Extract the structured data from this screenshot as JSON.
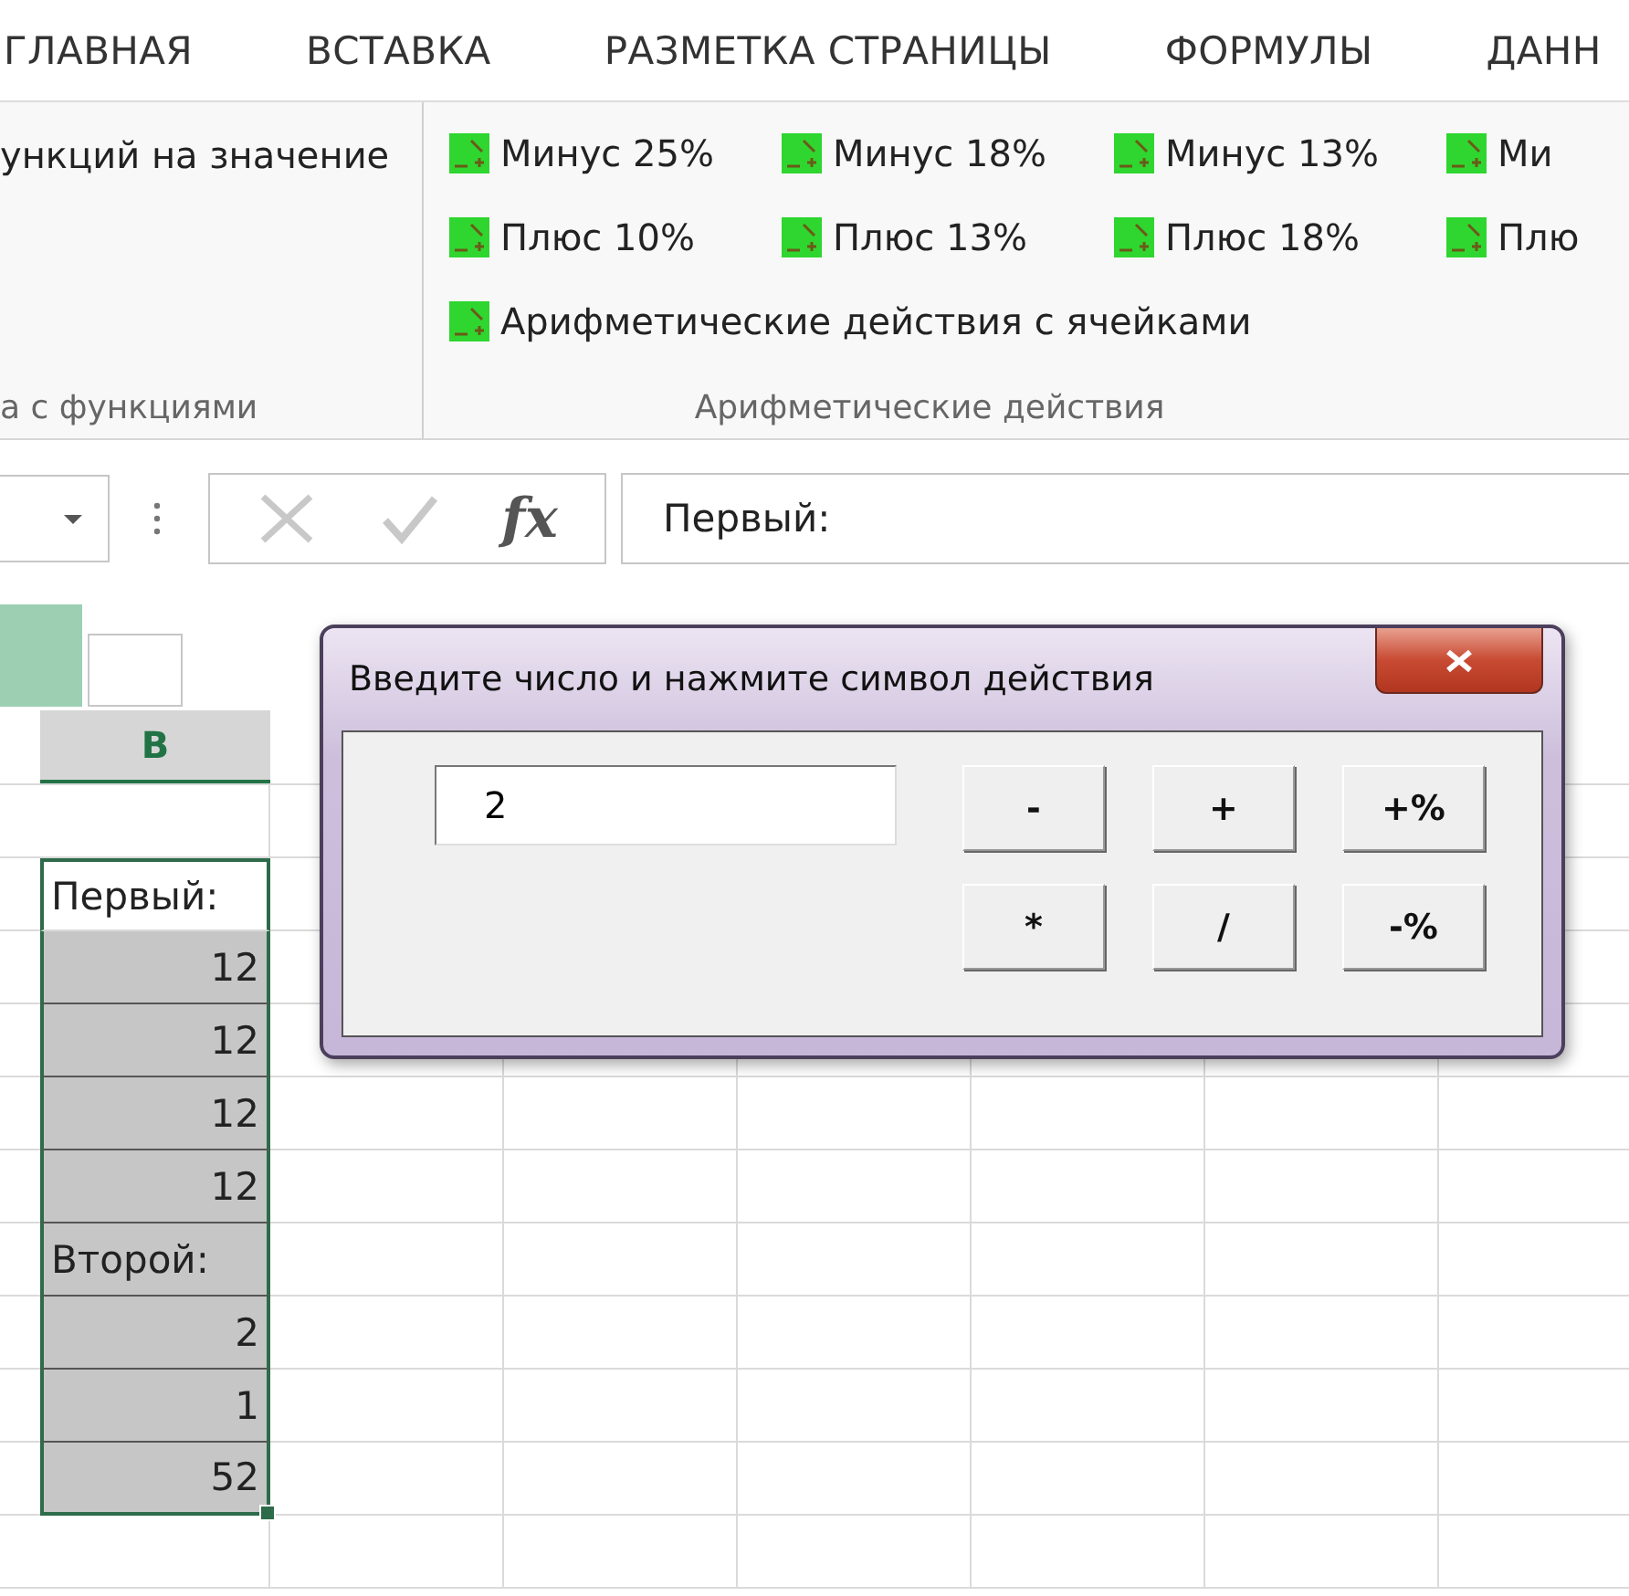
{
  "ribbon_tabs": [
    {
      "label": "ГЛАВНАЯ"
    },
    {
      "label": "ВСТАВКА"
    },
    {
      "label": "РАЗМЕТКА СТРАНИЦЫ"
    },
    {
      "label": "ФОРМУЛЫ"
    },
    {
      "label": "ДАНН"
    }
  ],
  "ribbon": {
    "left_group": {
      "items": [
        "ункций на значение"
      ],
      "label": "а с функциями"
    },
    "arith_group": {
      "items": [
        {
          "label": "Минус 25%",
          "kind": "percent"
        },
        {
          "label": "Минус 18%",
          "kind": "percent"
        },
        {
          "label": "Минус 13%",
          "kind": "percent"
        },
        {
          "label": "Ми",
          "kind": "percent"
        },
        {
          "label": "Плюс 10%",
          "kind": "percent"
        },
        {
          "label": "Плюс 13%",
          "kind": "percent"
        },
        {
          "label": "Плюс 18%",
          "kind": "percent"
        },
        {
          "label": "Плю",
          "kind": "percent"
        },
        {
          "label": "Арифметические действия с ячейками",
          "kind": "wide"
        }
      ],
      "label": "Арифметические действия"
    }
  },
  "formula_bar": {
    "fx": "fx",
    "value": "Первый:"
  },
  "sheet": {
    "column_headers": [
      {
        "label": "B",
        "selected": true
      }
    ],
    "cells": [
      {
        "text": "Первый:",
        "kind": "text",
        "active": true
      },
      {
        "text": "12",
        "kind": "number",
        "active": false
      },
      {
        "text": "12",
        "kind": "number",
        "active": false
      },
      {
        "text": "12",
        "kind": "number",
        "active": false
      },
      {
        "text": "12",
        "kind": "number",
        "active": false
      },
      {
        "text": "Второй:",
        "kind": "text",
        "active": false
      },
      {
        "text": "2",
        "kind": "number",
        "active": false
      },
      {
        "text": "1",
        "kind": "number",
        "active": false
      },
      {
        "text": "52",
        "kind": "number",
        "active": false
      }
    ]
  },
  "dialog": {
    "title": "Введите число и нажмите символ действия",
    "input_value": "2",
    "buttons": [
      "-",
      "+",
      "+%",
      "*",
      "/",
      "-%"
    ]
  }
}
